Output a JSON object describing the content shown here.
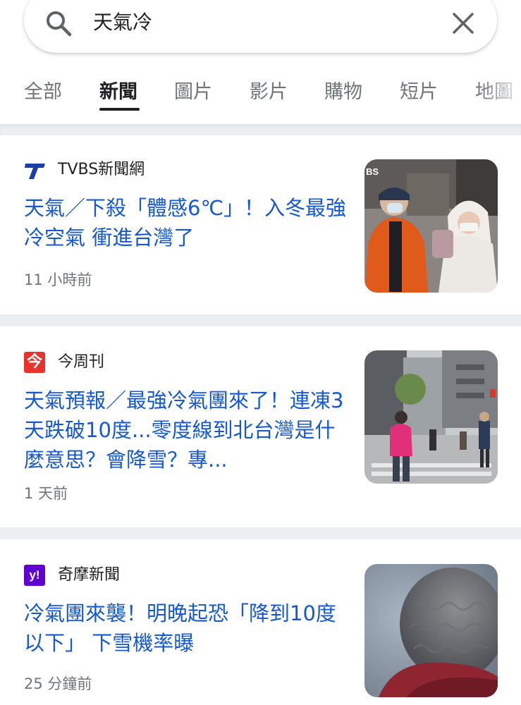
{
  "search": {
    "query": "天氣冷"
  },
  "tabs": [
    {
      "label": "全部",
      "active": false
    },
    {
      "label": "新聞",
      "active": true
    },
    {
      "label": "圖片",
      "active": false
    },
    {
      "label": "影片",
      "active": false
    },
    {
      "label": "購物",
      "active": false
    },
    {
      "label": "短片",
      "active": false
    },
    {
      "label": "地圖",
      "active": false
    }
  ],
  "articles": [
    {
      "source": "TVBS新聞網",
      "source_icon": "tvbs-logo-icon",
      "headline": "天氣／下殺「體感6℃」！入冬最強冷空氣 衝進台灣了",
      "time": "11 小時前",
      "thumbnail": "people-in-winter-coats-thumbnail",
      "thumb_text": "BS"
    },
    {
      "source": "今周刊",
      "source_icon": "jin-zhou-kan-logo-icon",
      "source_logo_char": "今",
      "headline": "天氣預報／最強冷氣團來了！連凍3天跌破10度...零度線到北台灣是什麼意思？會降雪？專...",
      "time": "1 天前",
      "thumbnail": "city-street-crosswalk-thumbnail"
    },
    {
      "source": "奇摩新聞",
      "source_icon": "yahoo-logo-icon",
      "source_logo_char": "y!",
      "headline": "冷氣團來襲！明晚起恐「降到10度以下」 下雪機率曝",
      "time": "25 分鐘前",
      "thumbnail": "knit-beanie-closeup-thumbnail"
    }
  ],
  "colors": {
    "headline": "#1558d6",
    "tvbs_logo": "#1a3fa8",
    "jzk_logo": "#e8322d",
    "yahoo_logo": "#6001d2"
  }
}
